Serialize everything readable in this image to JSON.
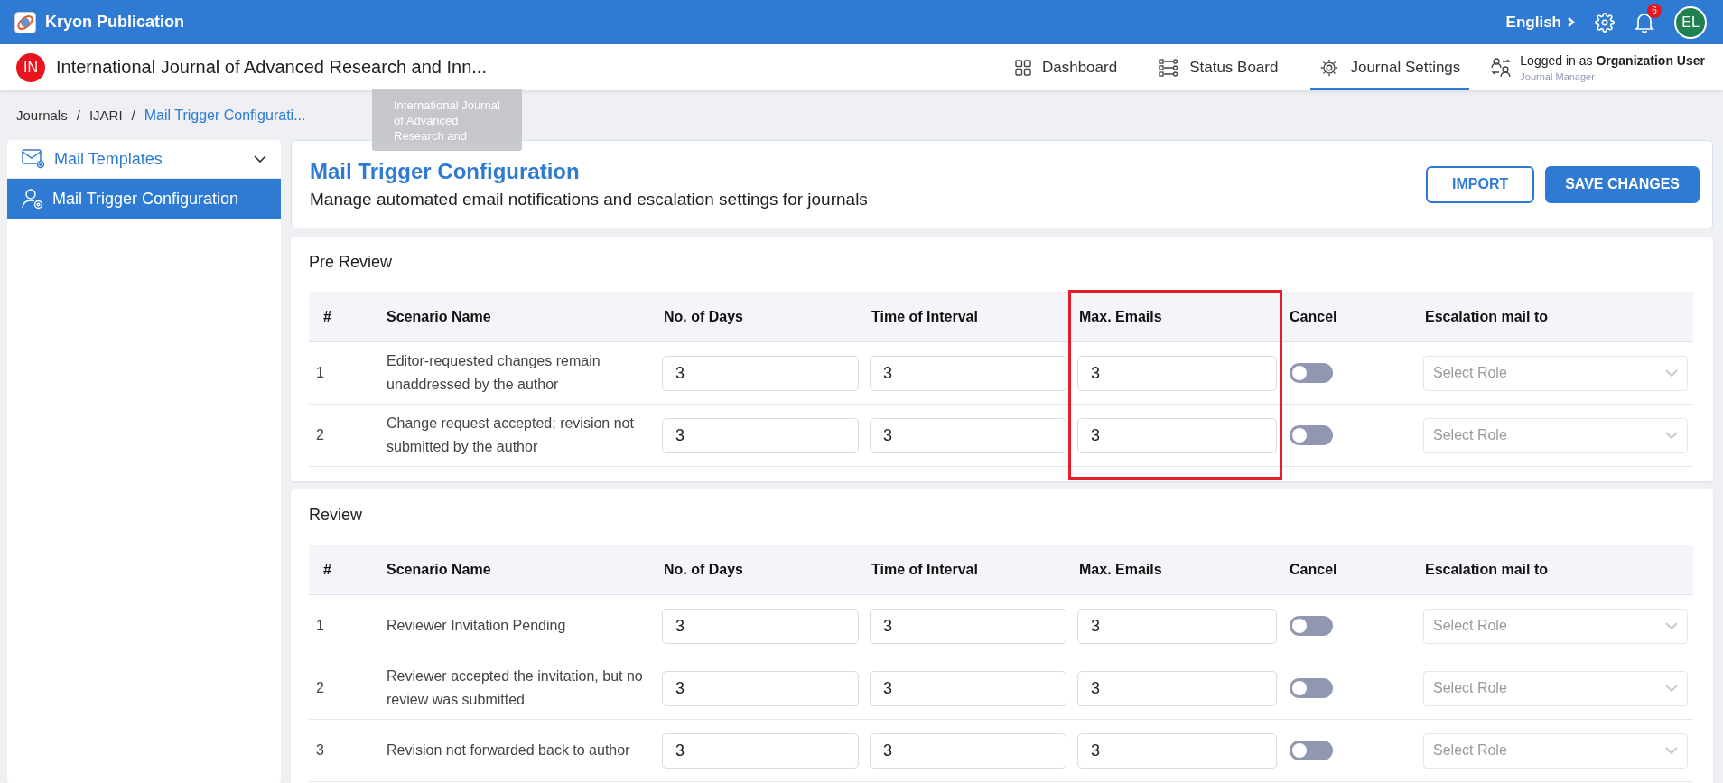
{
  "app": {
    "title": "Kryon Publication",
    "language": "English",
    "notification_count": "6",
    "avatar": "EL"
  },
  "journal": {
    "badge": "IN",
    "title": "International Journal of Advanced Research and Inn...",
    "tooltip": "International Journal of Advanced Research and"
  },
  "nav": {
    "tabs": [
      {
        "label": "Dashboard",
        "kind": "dashboard",
        "selected": false
      },
      {
        "label": "Status Board",
        "kind": "status",
        "selected": false
      },
      {
        "label": "Journal Settings",
        "kind": "settings",
        "selected": true
      }
    ]
  },
  "user": {
    "prefix": "Logged in as",
    "name": "Organization User",
    "role": "Journal Manager"
  },
  "breadcrumb": [
    {
      "kind": "link",
      "text": "Journals"
    },
    {
      "kind": "separator",
      "text": "/"
    },
    {
      "kind": "link",
      "text": "IJARI"
    },
    {
      "kind": "separator",
      "text": "/"
    },
    {
      "kind": "current",
      "text": "Mail Trigger Configurati..."
    }
  ],
  "sidebar": {
    "items": [
      {
        "label": "Mail Templates",
        "kind": "mail",
        "expanded": false,
        "selected": false
      },
      {
        "label": "Mail Trigger Configuration",
        "kind": "user",
        "selected": true
      }
    ]
  },
  "page": {
    "title": "Mail Trigger Configuration",
    "subtitle": "Manage automated email notifications and escalation settings for journals",
    "buttons": [
      {
        "label": "IMPORT",
        "kind": "outline"
      },
      {
        "label": "SAVE CHANGES",
        "kind": "primary"
      }
    ]
  },
  "sections": [
    {
      "title": "Pre Review",
      "columns": [
        {
          "label": "#",
          "highlighted": false
        },
        {
          "label": "Scenario Name",
          "highlighted": false
        },
        {
          "label": "No. of Days",
          "highlighted": false
        },
        {
          "label": "Time of Interval",
          "highlighted": false
        },
        {
          "label": "Max. Emails",
          "highlighted": true
        },
        {
          "label": "Cancel",
          "highlighted": false
        },
        {
          "label": "Escalation mail to",
          "highlighted": false
        }
      ],
      "rows": [
        {
          "number": "1",
          "scenario": "Editor-requested changes remain unaddressed by the author",
          "days": "3",
          "interval": "3",
          "max_emails": "3",
          "cancel": false,
          "escalation_placeholder": "Select Role"
        },
        {
          "number": "2",
          "scenario": "Change request accepted; revision not submitted by the author",
          "days": "3",
          "interval": "3",
          "max_emails": "3",
          "cancel": false,
          "escalation_placeholder": "Select Role"
        }
      ]
    },
    {
      "title": "Review",
      "columns": [
        {
          "label": "#",
          "highlighted": false
        },
        {
          "label": "Scenario Name",
          "highlighted": false
        },
        {
          "label": "No. of Days",
          "highlighted": false
        },
        {
          "label": "Time of Interval",
          "highlighted": false
        },
        {
          "label": "Max. Emails",
          "highlighted": false
        },
        {
          "label": "Cancel",
          "highlighted": false
        },
        {
          "label": "Escalation mail to",
          "highlighted": false
        }
      ],
      "rows": [
        {
          "number": "1",
          "scenario": "Reviewer Invitation Pending",
          "days": "3",
          "interval": "3",
          "max_emails": "3",
          "cancel": false,
          "escalation_placeholder": "Select Role"
        },
        {
          "number": "2",
          "scenario": "Reviewer accepted the invitation, but no review was submitted",
          "days": "3",
          "interval": "3",
          "max_emails": "3",
          "cancel": false,
          "escalation_placeholder": "Select Role"
        },
        {
          "number": "3",
          "scenario": "Revision not forwarded back to author",
          "days": "3",
          "interval": "3",
          "max_emails": "3",
          "cancel": false,
          "escalation_placeholder": "Select Role"
        }
      ]
    }
  ]
}
